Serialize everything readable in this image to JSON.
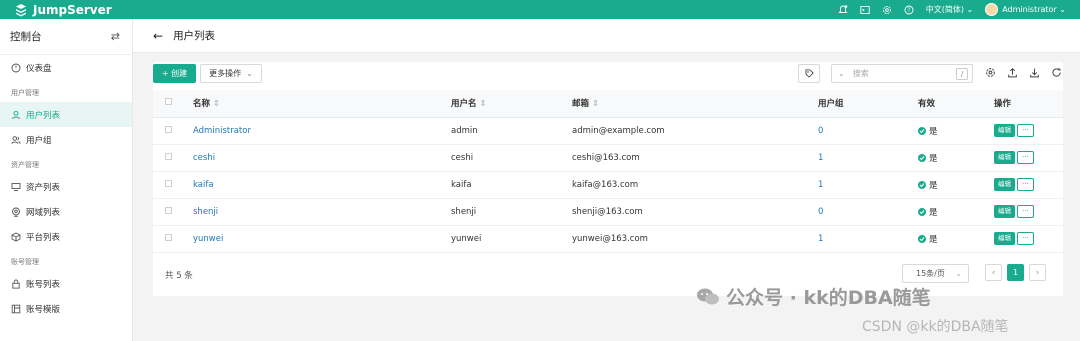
{
  "topbar": {
    "brand": "JumpServer",
    "language": "中文(简体)",
    "user": "Administrator",
    "accent": "#1aaa8e"
  },
  "sidebar": {
    "title": "控制台",
    "items": [
      {
        "label": "仪表盘",
        "icon": "dashboard-icon"
      },
      {
        "section": "用户管理"
      },
      {
        "label": "用户列表",
        "icon": "user-icon",
        "active": true
      },
      {
        "label": "用户组",
        "icon": "user-group-icon"
      },
      {
        "section": "资产管理"
      },
      {
        "label": "资产列表",
        "icon": "server-icon"
      },
      {
        "label": "网域列表",
        "icon": "globe-icon"
      },
      {
        "label": "平台列表",
        "icon": "platform-icon"
      },
      {
        "section": "账号管理"
      },
      {
        "label": "账号列表",
        "icon": "lock-icon"
      },
      {
        "label": "账号模版",
        "icon": "template-icon"
      }
    ]
  },
  "header": {
    "title": "用户列表"
  },
  "toolbar": {
    "create_label": "+ 创建",
    "more_label": "更多操作",
    "search_placeholder": "搜索",
    "search_shortcut": "/"
  },
  "table": {
    "columns": {
      "name": "名称",
      "username": "用户名",
      "email": "邮箱",
      "groups": "用户组",
      "valid": "有效",
      "actions": "操作"
    },
    "rows": [
      {
        "name": "Administrator",
        "username": "admin",
        "email": "admin@example.com",
        "groups": "0",
        "valid": "是"
      },
      {
        "name": "ceshi",
        "username": "ceshi",
        "email": "ceshi@163.com",
        "groups": "1",
        "valid": "是"
      },
      {
        "name": "kaifa",
        "username": "kaifa",
        "email": "kaifa@163.com",
        "groups": "1",
        "valid": "是"
      },
      {
        "name": "shenji",
        "username": "shenji",
        "email": "shenji@163.com",
        "groups": "0",
        "valid": "是"
      },
      {
        "name": "yunwei",
        "username": "yunwei",
        "email": "yunwei@163.com",
        "groups": "1",
        "valid": "是"
      }
    ],
    "edit_label": "编辑",
    "more_label": "···"
  },
  "pagination": {
    "total": "共 5 条",
    "page_size": "15条/页",
    "current": "1",
    "prev": "‹",
    "next": "›"
  },
  "watermark": {
    "main": "公众号 · kk的DBA随笔",
    "sub": "CSDN @kk的DBA随笔"
  }
}
